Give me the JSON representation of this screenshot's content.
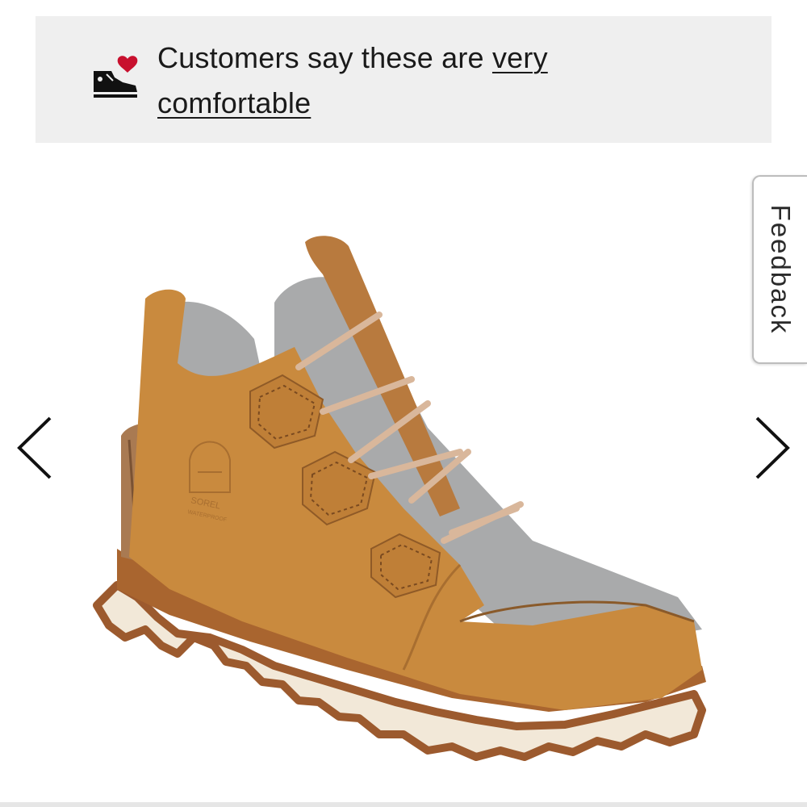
{
  "banner": {
    "icon": "sneaker-heart-icon",
    "text_prefix": "Customers say these are ",
    "link_text": "very comfortable",
    "heart_color": "#c8102e",
    "background": "#efefef"
  },
  "carousel": {
    "prev_icon": "chevron-left-icon",
    "next_icon": "chevron-right-icon"
  },
  "product": {
    "brand_logo": "SOREL",
    "brand_sub": "WATERPROOF",
    "upper_color": "#c98a3e",
    "felt_color": "#a9aaab",
    "sole_color": "#f2e8d8"
  },
  "feedback": {
    "label": "Feedback"
  }
}
